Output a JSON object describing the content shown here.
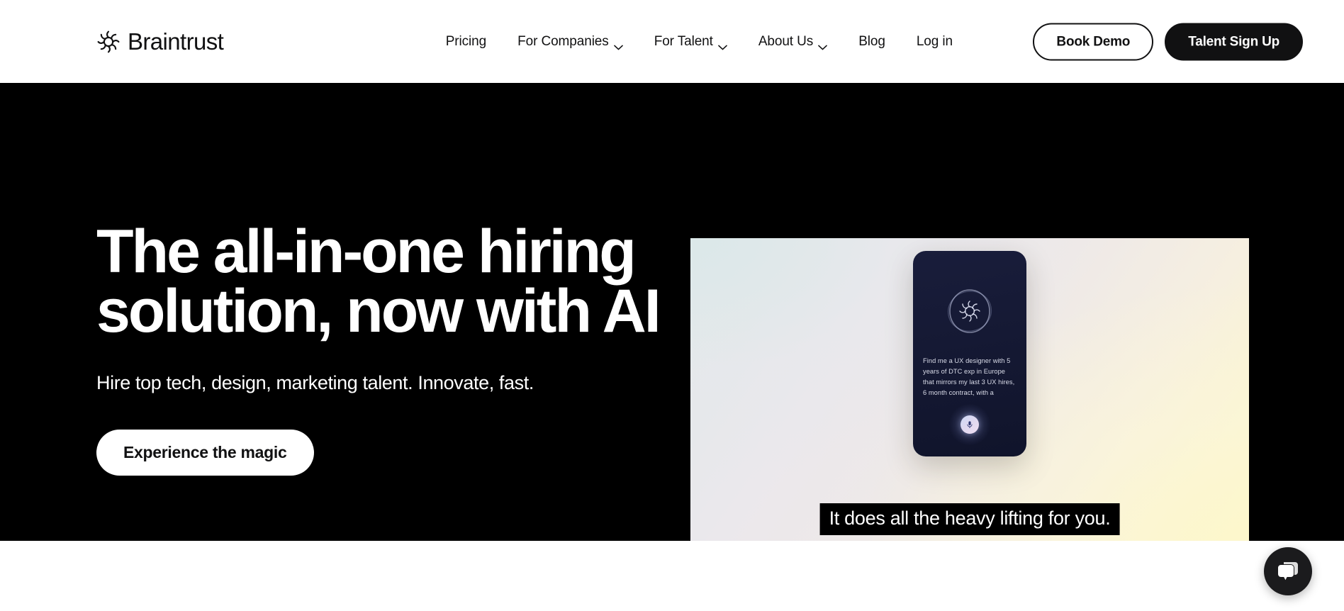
{
  "brand": {
    "name": "Braintrust",
    "logo_icon": "sun-gear-icon"
  },
  "nav": {
    "items": [
      {
        "label": "Pricing",
        "has_dropdown": false
      },
      {
        "label": "For Companies",
        "has_dropdown": true
      },
      {
        "label": "For Talent",
        "has_dropdown": true
      },
      {
        "label": "About Us",
        "has_dropdown": true
      },
      {
        "label": "Blog",
        "has_dropdown": false
      },
      {
        "label": "Log in",
        "has_dropdown": false
      }
    ]
  },
  "header_actions": {
    "book_demo_label": "Book Demo",
    "talent_signup_label": "Talent Sign Up"
  },
  "hero": {
    "title_line1": "The all-in-one hiring",
    "title_line2": "solution, now with AI",
    "subtitle": "Hire top tech, design, marketing talent. Innovate, fast.",
    "cta_label": "Experience the magic",
    "background_color": "#000000"
  },
  "media": {
    "caption": "It does all the heavy lifting for you.",
    "phone": {
      "prompt_text": "Find me a UX designer with 5 years of DTC exp in Europe that mirrors my last 3 UX hires, 6 month contract, with a",
      "orb_icon": "sun-gear-icon",
      "mic_icon": "microphone-icon"
    }
  },
  "chat": {
    "icon": "chat-bubbles-icon"
  },
  "colors": {
    "brand_black": "#111112",
    "hero_background": "#000000",
    "page_background": "#ffffff",
    "phone_navy": "#141832",
    "gradient_left": "#dfe9e9",
    "gradient_right": "#fdf8c8"
  }
}
